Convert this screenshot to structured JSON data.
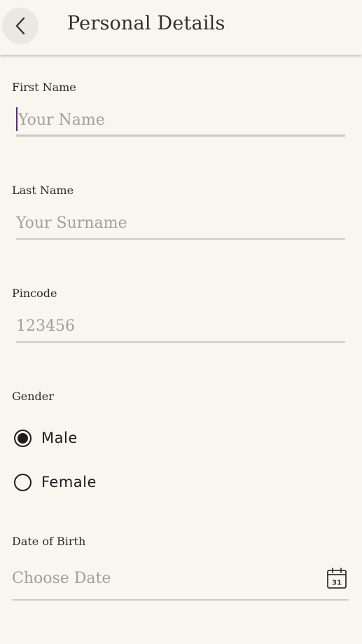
{
  "header": {
    "title": "Personal Details"
  },
  "form": {
    "first_name": {
      "label": "First Name",
      "value": "",
      "placeholder": "Your Name"
    },
    "last_name": {
      "label": "Last Name",
      "value": "",
      "placeholder": "Your Surname"
    },
    "pincode": {
      "label": "Pincode",
      "value": "",
      "placeholder": "123456"
    },
    "gender": {
      "label": "Gender",
      "options": [
        {
          "label": "Male",
          "selected": true
        },
        {
          "label": "Female",
          "selected": false
        }
      ]
    },
    "date_of_birth": {
      "label": "Date of Birth",
      "value": "",
      "placeholder": "Choose Date",
      "calendar_day": "31"
    }
  },
  "icons": {
    "back": "back-arrow-icon",
    "calendar": "calendar-icon"
  },
  "colors": {
    "background": "#f9f6ef",
    "caret": "#5a2d6e",
    "placeholder": "#a3a09a",
    "underline": "#cfccc6"
  }
}
